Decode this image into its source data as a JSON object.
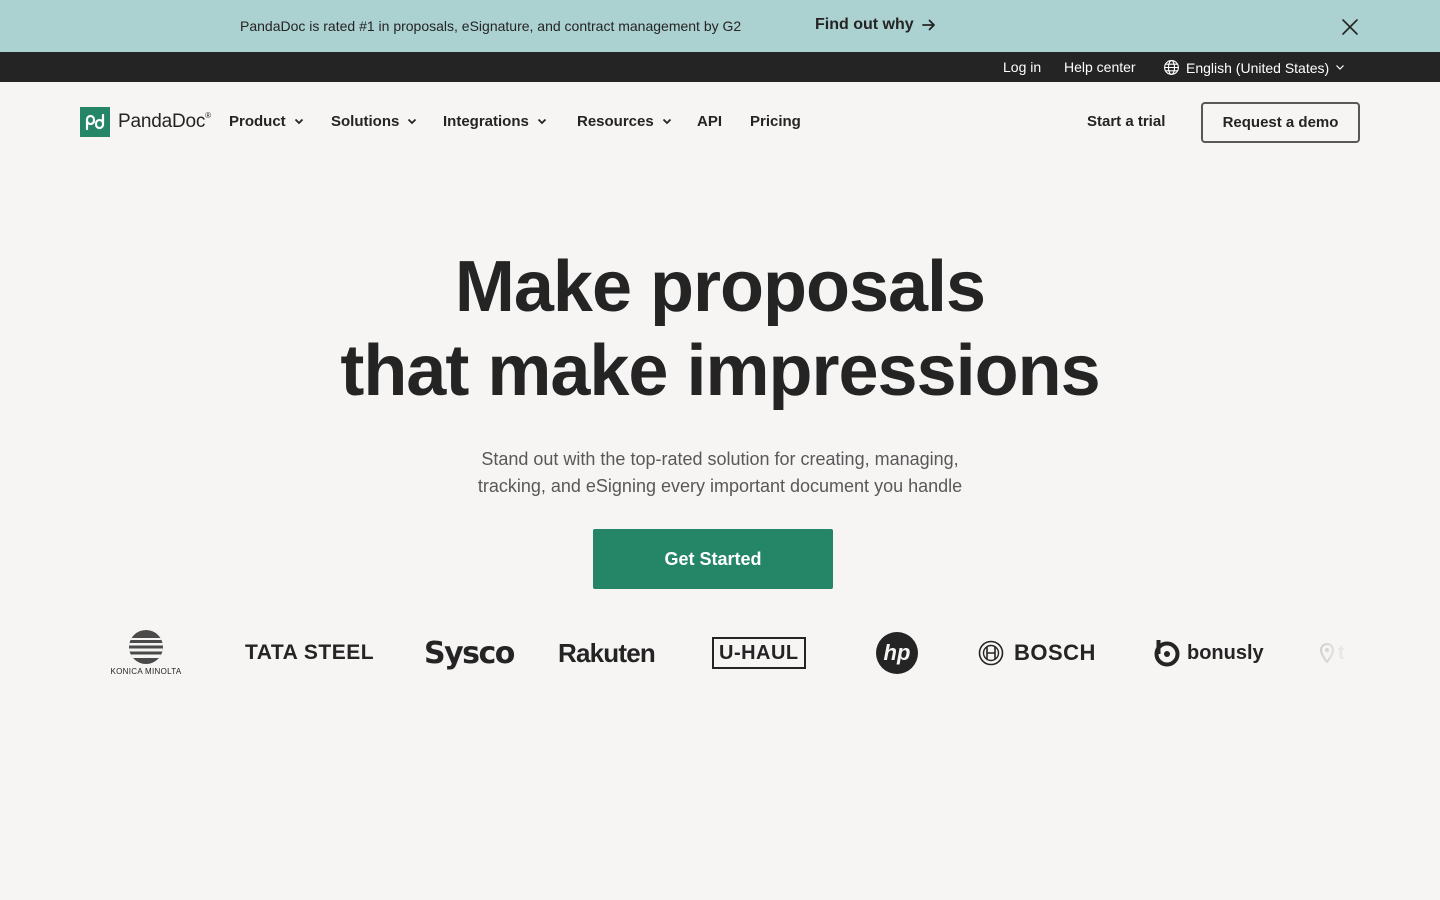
{
  "promo": {
    "text": "PandaDoc is rated #1 in proposals, eSignature, and contract management by G2",
    "link": "Find out why"
  },
  "utility": {
    "login": "Log in",
    "help": "Help center",
    "language": "English (United States)"
  },
  "nav": {
    "logo_text": "PandaDoc",
    "items": [
      "Product",
      "Solutions",
      "Integrations",
      "Resources",
      "API",
      "Pricing"
    ],
    "start_trial": "Start a trial",
    "request_demo": "Request a demo"
  },
  "hero": {
    "title_line1": "Make proposals",
    "title_line2": "that make impressions",
    "subtitle_line1": "Stand out with the top-rated solution for creating, managing,",
    "subtitle_line2": "tracking, and eSigning every important document you handle",
    "cta": "Get Started"
  },
  "logos": {
    "konica": "KONICA MINOLTA",
    "tata": "TATA STEEL",
    "sysco": "Sysco",
    "rakuten": "Rakuten",
    "uhaul": "U-HAUL",
    "hp": "hp",
    "bosch": "BOSCH",
    "bonusly": "bonusly",
    "partial": "t"
  },
  "colors": {
    "promo_bg": "#acd1d1",
    "utility_bg": "#242424",
    "page_bg": "#f7f5f4",
    "brand_green": "#248567",
    "text": "#242424"
  },
  "icons": {
    "promo_arrow": "arrow-right-icon",
    "promo_close": "close-icon",
    "language": "globe-icon",
    "dropdown": "chevron-down-icon"
  }
}
